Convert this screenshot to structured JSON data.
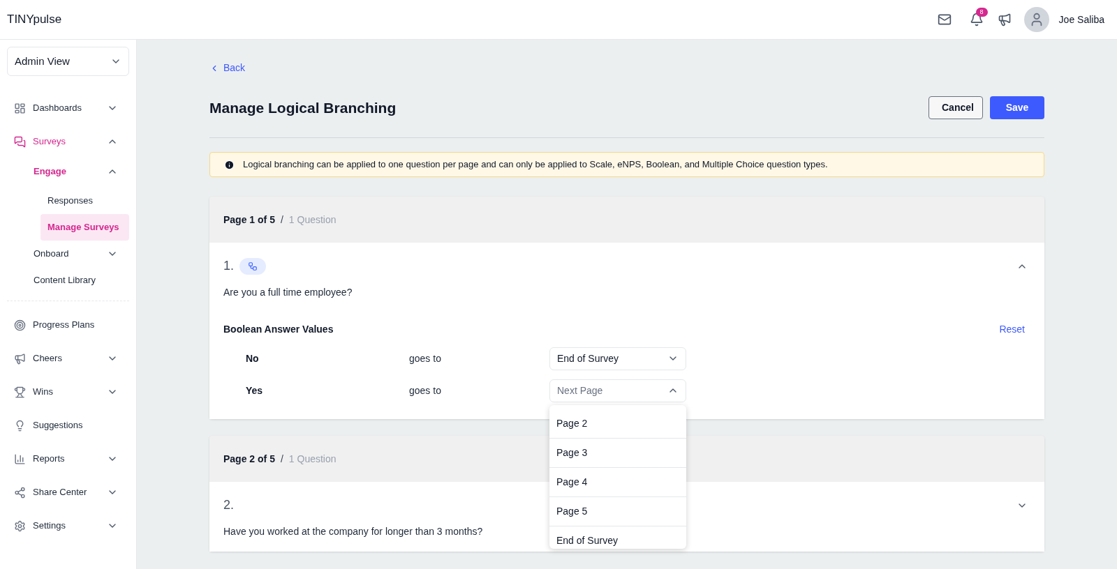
{
  "header": {
    "brand": "TINYpulse",
    "notification_count": "8",
    "user_name": "Joe Saliba"
  },
  "sidebar": {
    "view_select": "Admin View",
    "sections": [
      [
        {
          "label": "Dashboards",
          "kind": "group",
          "expanded": false,
          "selected": false
        },
        {
          "label": "Surveys",
          "kind": "group",
          "expanded": true,
          "selected": true,
          "children": [
            {
              "label": "Engage",
              "kind": "group",
              "expanded": true,
              "selected": true,
              "children": [
                {
                  "label": "Responses",
                  "kind": "link",
                  "selected": false
                },
                {
                  "label": "Manage Surveys",
                  "kind": "link",
                  "selected": true
                }
              ]
            },
            {
              "label": "Onboard",
              "kind": "group",
              "expanded": false,
              "selected": false
            },
            {
              "label": "Content Library",
              "kind": "link",
              "selected": false
            }
          ]
        }
      ],
      [
        {
          "label": "Progress Plans",
          "kind": "link",
          "selected": false
        },
        {
          "label": "Cheers",
          "kind": "group",
          "expanded": false,
          "selected": false
        },
        {
          "label": "Wins",
          "kind": "group",
          "expanded": false,
          "selected": false
        },
        {
          "label": "Suggestions",
          "kind": "link",
          "selected": false
        },
        {
          "label": "Reports",
          "kind": "group",
          "expanded": false,
          "selected": false
        },
        {
          "label": "Share Center",
          "kind": "group",
          "expanded": false,
          "selected": false
        },
        {
          "label": "Settings",
          "kind": "group",
          "expanded": false,
          "selected": false
        }
      ]
    ]
  },
  "main": {
    "back_link": "Back",
    "title": "Manage Logical Branching",
    "buttons": [
      {
        "label": "Cancel",
        "kind": "secondary"
      },
      {
        "label": "Save",
        "kind": "primary"
      }
    ],
    "notice": "Logical branching can be applied to one question per page and can only be applied to Scale, eNPS, Boolean, and Multiple Choice question types.",
    "pages": [
      {
        "header": "Page 1 of 5",
        "separator": "/",
        "count": "1 Question",
        "questions": [
          {
            "number": "1.",
            "branching": true,
            "expanded": true,
            "text": "Are you a full time employee?",
            "values_title": "Boolean Answer Values",
            "reset": "Reset",
            "rules": [
              {
                "answer": "No",
                "connector": "goes to",
                "value": "End of Survey",
                "open": false
              },
              {
                "answer": "Yes",
                "connector": "goes to",
                "placeholder": "Next Page",
                "open": true,
                "options": [
                  "Page 2",
                  "Page 3",
                  "Page 4",
                  "Page 5",
                  "End of Survey"
                ]
              }
            ]
          }
        ]
      },
      {
        "header": "Page 2 of 5",
        "separator": "/",
        "count": "1 Question",
        "questions": [
          {
            "number": "2.",
            "branching": false,
            "expanded": false,
            "text": "Have you worked at the company for longer than 3 months?"
          }
        ]
      }
    ]
  }
}
